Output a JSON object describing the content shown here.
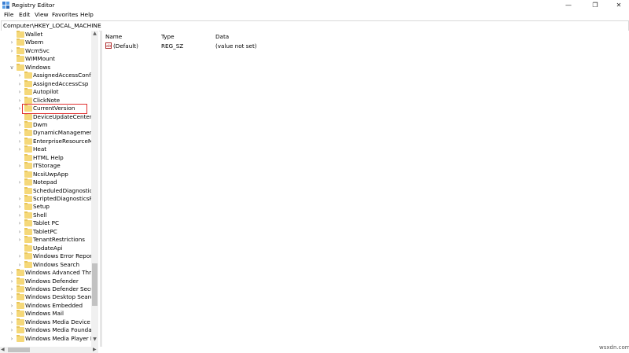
{
  "window": {
    "title": "Registry Editor",
    "controls": {
      "minimize": "—",
      "maximize": "❐",
      "close": "✕"
    }
  },
  "menu": [
    "File",
    "Edit",
    "View",
    "Favorites",
    "Help"
  ],
  "address": "Computer\\HKEY_LOCAL_MACHINE",
  "tree": {
    "items": [
      {
        "label": "Wallet",
        "expandable": false
      },
      {
        "label": "Wbem",
        "expandable": true
      },
      {
        "label": "WcmSvc",
        "expandable": true
      },
      {
        "label": "WIMMount",
        "expandable": false
      },
      {
        "label": "Windows",
        "expandable": true,
        "expanded": true
      },
      {
        "label": "AssignedAccessConf",
        "expandable": true
      },
      {
        "label": "AssignedAccessCsp",
        "expandable": true
      },
      {
        "label": "Autopilot",
        "expandable": true
      },
      {
        "label": "ClickNote",
        "expandable": true
      },
      {
        "label": "CurrentVersion",
        "expandable": true,
        "highlighted": true
      },
      {
        "label": "DeviceUpdateCenter",
        "expandable": false
      },
      {
        "label": "Dwm",
        "expandable": true
      },
      {
        "label": "DynamicManagemer",
        "expandable": true
      },
      {
        "label": "EnterpriseResourceM",
        "expandable": true
      },
      {
        "label": "Heat",
        "expandable": true
      },
      {
        "label": "HTML Help",
        "expandable": false
      },
      {
        "label": "ITStorage",
        "expandable": true
      },
      {
        "label": "NcsiUwpApp",
        "expandable": false
      },
      {
        "label": "Notepad",
        "expandable": true
      },
      {
        "label": "ScheduledDiagnostic",
        "expandable": false
      },
      {
        "label": "ScriptedDiagnosticsP",
        "expandable": true
      },
      {
        "label": "Setup",
        "expandable": true
      },
      {
        "label": "Shell",
        "expandable": true
      },
      {
        "label": "Tablet PC",
        "expandable": true
      },
      {
        "label": "TabletPC",
        "expandable": true
      },
      {
        "label": "TenantRestrictions",
        "expandable": true
      },
      {
        "label": "UpdateApi",
        "expandable": false
      },
      {
        "label": "Windows Error Repor",
        "expandable": true
      },
      {
        "label": "Windows Search",
        "expandable": true
      },
      {
        "label": "Windows Advanced Thr",
        "expandable": true
      },
      {
        "label": "Windows Defender",
        "expandable": true
      },
      {
        "label": "Windows Defender Secu",
        "expandable": true
      },
      {
        "label": "Windows Desktop Searc",
        "expandable": true
      },
      {
        "label": "Windows Embedded",
        "expandable": true
      },
      {
        "label": "Windows Mail",
        "expandable": true
      },
      {
        "label": "Windows Media Device",
        "expandable": true
      },
      {
        "label": "Windows Media Founda",
        "expandable": true
      },
      {
        "label": "Windows Media Player N",
        "expandable": true
      }
    ]
  },
  "values": {
    "columns": {
      "name": "Name",
      "type": "Type",
      "data": "Data"
    },
    "rows": [
      {
        "icon": "ab",
        "name": "(Default)",
        "type": "REG_SZ",
        "data": "(value not set)"
      }
    ]
  },
  "watermark": "wsxdn.com"
}
